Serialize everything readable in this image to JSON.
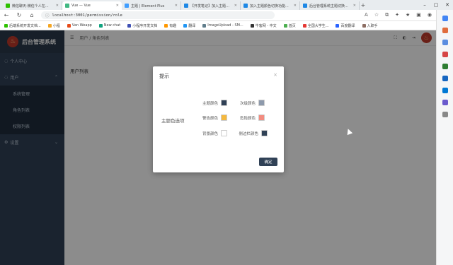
{
  "browser": {
    "tabs": [
      {
        "title": "微信聊天-微信个人在...",
        "color": "#2dc100"
      },
      {
        "title": "Vue — Vue",
        "color": "#42b883",
        "active": true
      },
      {
        "title": "主题 | Element Plus",
        "color": "#409eff"
      },
      {
        "title": "【开发笔记】加入主题色...",
        "color": "#1e88e5"
      },
      {
        "title": "加入主题颜色切换功能...",
        "color": "#1e88e5"
      },
      {
        "title": "后台管理系统主题切换...",
        "color": "#1e88e5"
      }
    ],
    "url": "localhost:3001/permission/role",
    "bookmarks": [
      "后端系统开发文档...",
      "小程",
      "Van Weapp",
      "New chat",
      "小程序开发文档",
      "有趣",
      "翻译",
      "ImageUpload - SM...",
      "牛客网 - 中文",
      "首页",
      "全国大学生...",
      "百度翻译",
      "入职手"
    ]
  },
  "sidebar": {
    "title": "后台管理系统",
    "items": [
      {
        "label": "个人中心",
        "icon": "user-icon"
      },
      {
        "label": "用户",
        "icon": "people-icon",
        "expanded": true
      },
      {
        "label": "系统管理",
        "icon": "",
        "sub": true
      },
      {
        "label": "角色列表",
        "icon": "",
        "sub": true
      },
      {
        "label": "权限列表",
        "icon": "",
        "sub": true
      },
      {
        "label": "设置",
        "icon": "gear-icon"
      }
    ]
  },
  "header": {
    "breadcrumb_home": "用户",
    "breadcrumb_sep": "/",
    "breadcrumb_current": "角色列表"
  },
  "main": {
    "page_title": "用户列表"
  },
  "dialog": {
    "title": "提示",
    "close": "×",
    "group_label": "主题色选项",
    "rows": [
      {
        "label_a": "主题颜色",
        "color_a": "#304156",
        "label_b": "次级颜色",
        "color_b": "#8e9aac"
      },
      {
        "label_a": "警告颜色",
        "color_a": "#f5b93f",
        "label_b": "危险颜色",
        "color_b": "#f38c80"
      },
      {
        "label_a": "背景颜色",
        "color_a": "#ffffff",
        "label_b": "侧边栏颜色",
        "color_b": "#304156"
      }
    ],
    "confirm": "确定"
  },
  "colors": {
    "sidebar_bg": "#304156",
    "accent": "#c0392b"
  }
}
